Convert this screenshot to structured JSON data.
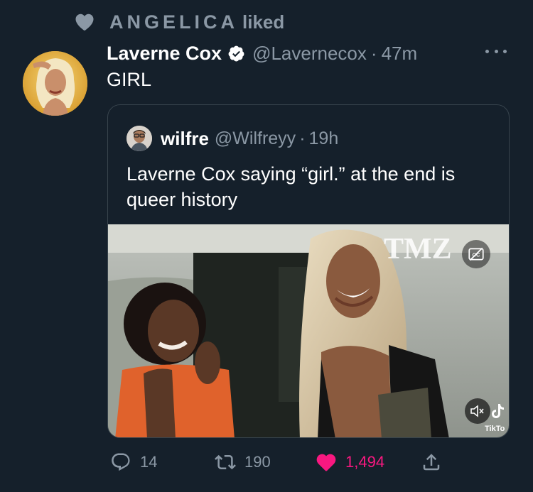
{
  "social_context": {
    "name": "ANGELICA",
    "suffix": "liked"
  },
  "tweet": {
    "author_name": "Laverne Cox",
    "author_handle": "@Lavernecox",
    "separator": "·",
    "time": "47m",
    "text": "GIRL"
  },
  "quote": {
    "author_name": "wilfre",
    "author_handle": "@Wilfreyy",
    "separator": "·",
    "time": "19h",
    "text": "Laverne Cox saying “girl.” at the end is queer history",
    "media": {
      "watermark": "TMZ",
      "tiktok_label": "TikTo"
    }
  },
  "actions": {
    "replies": "14",
    "retweets": "190",
    "likes": "1,494",
    "liked": true
  },
  "icons": {
    "liked-heart": "heart-icon",
    "verified": "verified-badge-icon",
    "more": "more-options-icon",
    "reply": "reply-icon",
    "retweet": "retweet-icon",
    "like": "like-icon",
    "share": "share-icon",
    "captions": "captions-icon",
    "mute": "mute-icon",
    "tiktok": "tiktok-logo-icon"
  },
  "colors": {
    "background": "#15202b",
    "secondary_text": "#8b98a5",
    "border": "#38444d",
    "verified": "#ffffff",
    "like": "#f91880"
  }
}
